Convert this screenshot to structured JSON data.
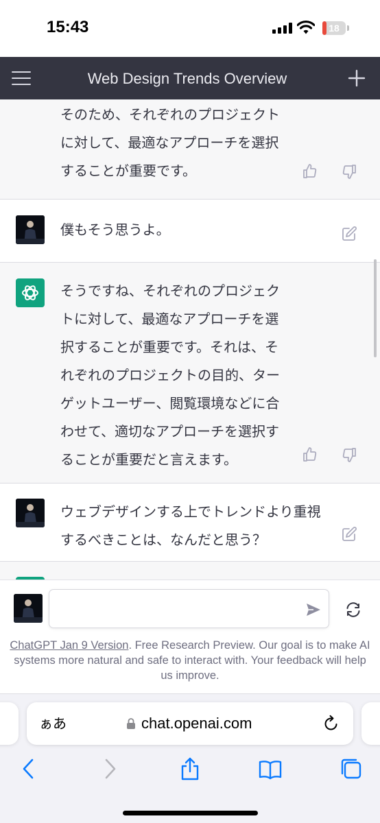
{
  "status_bar": {
    "time": "15:43",
    "battery_level": "18",
    "battery_fraction": 0.18
  },
  "header": {
    "title": "Web Design Trends Overview",
    "menu_icon": "hamburger-menu-icon",
    "new_chat_icon": "plus-icon"
  },
  "messages": [
    {
      "role": "assistant",
      "lines": [
        "そのため、それぞれのプロジェクト",
        "に対して、最適なアプローチを選択",
        "することが重要です。"
      ]
    },
    {
      "role": "user",
      "lines": [
        "僕もそう思うよ。"
      ]
    },
    {
      "role": "assistant",
      "lines": [
        "そうですね、それぞれのプロジェク",
        "トに対して、最適なアプローチを選",
        "択することが重要です。それは、そ",
        "れぞれのプロジェクトの目的、ター",
        "ゲットユーザー、閲覧環境などに合",
        "わせて、適切なアプローチを選択す",
        "ることが重要だと言えます。"
      ]
    },
    {
      "role": "user",
      "lines": [
        "ウェブデザインする上でトレンドより重視",
        "するべきことは、なんだと思う？"
      ]
    }
  ],
  "input": {
    "value": "",
    "placeholder": ""
  },
  "disclaimer": {
    "link_text": "ChatGPT Jan 9 Version",
    "text": ". Free Research Preview. Our goal is to make AI systems more natural and safe to interact with. Your feedback will help us improve."
  },
  "browser": {
    "aa_label": "ぁあ",
    "url": "chat.openai.com"
  },
  "colors": {
    "header_bg": "#343541",
    "assistant_bg": "#f7f7f8",
    "gpt_green": "#10a37f",
    "battery_red": "#e84a3c",
    "ios_blue": "#0a7aff"
  },
  "icons": [
    "thumbs-up-icon",
    "thumbs-down-icon",
    "edit-icon",
    "send-icon",
    "regenerate-icon",
    "lock-icon",
    "reload-icon",
    "back-icon",
    "forward-icon",
    "share-icon",
    "bookmarks-icon",
    "tabs-icon"
  ]
}
